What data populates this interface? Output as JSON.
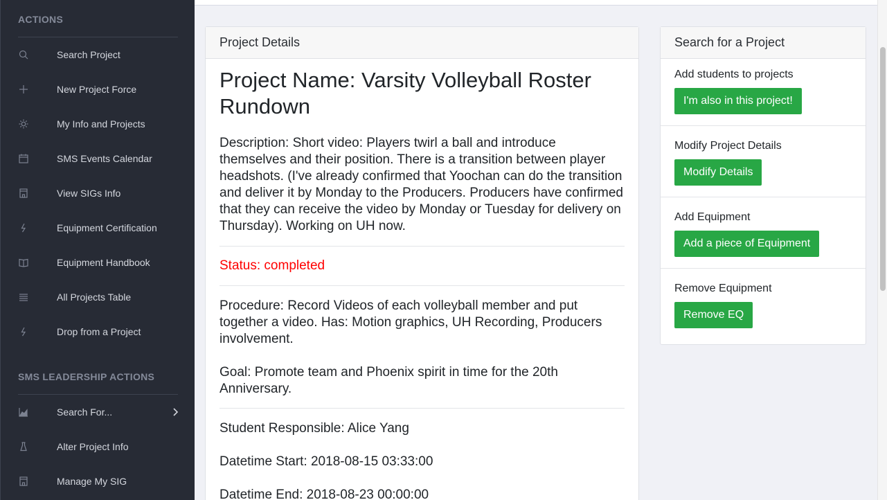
{
  "sidebar": {
    "actions_heading": "ACTIONS",
    "items": [
      {
        "label": "Search Project",
        "icon": "search-icon"
      },
      {
        "label": "New Project Force",
        "icon": "plus-icon"
      },
      {
        "label": "My Info and Projects",
        "icon": "sun-icon"
      },
      {
        "label": "SMS Events Calendar",
        "icon": "calendar-icon"
      },
      {
        "label": "View SIGs Info",
        "icon": "building-icon"
      },
      {
        "label": "Equipment Certification",
        "icon": "lightning-icon"
      },
      {
        "label": "Equipment Handbook",
        "icon": "book-icon"
      },
      {
        "label": "All Projects Table",
        "icon": "list-icon"
      },
      {
        "label": "Drop from a Project",
        "icon": "lightning-icon"
      }
    ],
    "leadership_heading": "SMS LEADERSHIP ACTIONS",
    "leadership_items": [
      {
        "label": "Search For...",
        "icon": "area-chart-icon"
      },
      {
        "label": "Alter Project Info",
        "icon": "flask-icon"
      },
      {
        "label": "Manage My SIG",
        "icon": "building-icon"
      }
    ]
  },
  "details": {
    "header": "Project Details",
    "project_name": "Project Name: Varsity Volleyball Roster Rundown",
    "description": "Description: Short video: Players twirl a ball and introduce themselves and their position. There is a transition between player headshots. (I've already confirmed that Yoochan can do the transition and deliver it by Monday to the Producers. Producers have confirmed that they can receive the video by Monday or Tuesday for delivery on Thursday). Working on UH now.",
    "status": "Status: completed",
    "procedure": "Procedure: Record Videos of each volleyball member and put together a video. Has: Motion graphics, UH Recording, Producers involvement.",
    "goal": "Goal: Promote team and Phoenix spirit in time for the 20th Anniversary.",
    "student": "Student Responsible: Alice Yang",
    "start": "Datetime Start: 2018-08-15 03:33:00",
    "end": "Datetime End: 2018-08-23 00:00:00"
  },
  "search_card": {
    "header": "Search for a Project",
    "sections": [
      {
        "label": "Add students to projects",
        "button": "I'm also in this project!"
      },
      {
        "label": "Modify Project Details",
        "button": "Modify Details"
      },
      {
        "label": "Add Equipment",
        "button": "Add a piece of Equipment"
      },
      {
        "label": "Remove Equipment",
        "button": "Remove EQ"
      }
    ]
  },
  "colors": {
    "sidebar_bg": "#272b35",
    "button_green": "#28a745",
    "status_red": "#ff0000"
  }
}
